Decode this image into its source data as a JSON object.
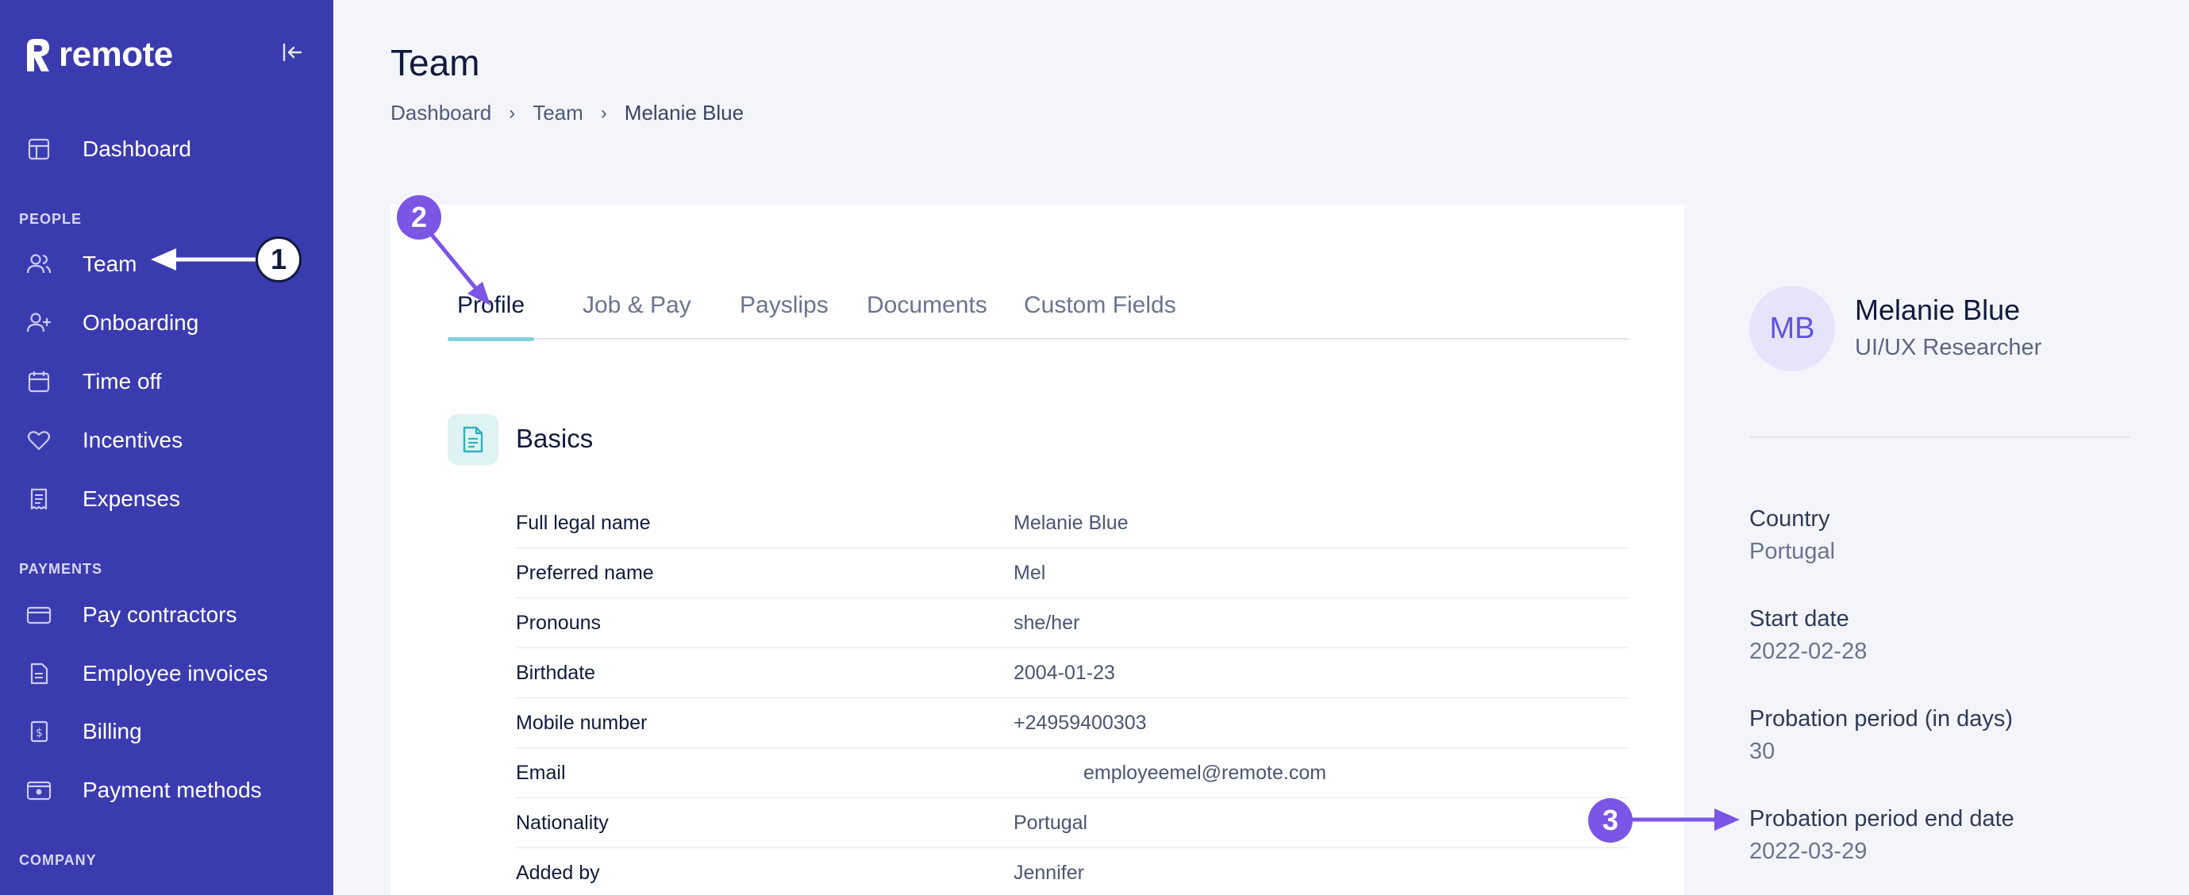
{
  "app": {
    "logo_text": "remote",
    "brand_color": "#3b3bb0"
  },
  "sidebar": {
    "collapse_icon": "collapse-left-icon",
    "sections": {
      "people": "PEOPLE",
      "payments": "PAYMENTS",
      "company": "COMPANY"
    },
    "items": [
      {
        "label": "Dashboard",
        "icon": "layout-icon"
      },
      {
        "label": "Team",
        "icon": "users-icon"
      },
      {
        "label": "Onboarding",
        "icon": "user-plus-icon"
      },
      {
        "label": "Time off",
        "icon": "calendar-icon"
      },
      {
        "label": "Incentives",
        "icon": "heart-icon"
      },
      {
        "label": "Expenses",
        "icon": "receipt-icon"
      },
      {
        "label": "Pay contractors",
        "icon": "credit-card-icon"
      },
      {
        "label": "Employee invoices",
        "icon": "invoice-icon"
      },
      {
        "label": "Billing",
        "icon": "dollar-doc-icon"
      },
      {
        "label": "Payment methods",
        "icon": "wallet-icon"
      }
    ]
  },
  "header": {
    "title": "Team",
    "breadcrumb": [
      "Dashboard",
      "Team",
      "Melanie Blue"
    ]
  },
  "tabs": [
    {
      "label": "Profile",
      "active": true
    },
    {
      "label": "Job & Pay",
      "active": false
    },
    {
      "label": "Payslips",
      "active": false
    },
    {
      "label": "Documents",
      "active": false
    },
    {
      "label": "Custom Fields",
      "active": false
    }
  ],
  "basics": {
    "title": "Basics",
    "rows": [
      {
        "key": "Full legal name",
        "value": "Melanie Blue"
      },
      {
        "key": "Preferred name",
        "value": "Mel"
      },
      {
        "key": "Pronouns",
        "value": "she/her"
      },
      {
        "key": "Birthdate",
        "value": "2004-01-23"
      },
      {
        "key": "Mobile number",
        "value": "+24959400303"
      },
      {
        "key": "Email",
        "value": "employeemel@remote.com"
      },
      {
        "key": "Nationality",
        "value": "Portugal"
      },
      {
        "key": "Added by",
        "value": "Jennifer"
      }
    ]
  },
  "employee": {
    "initials": "MB",
    "name": "Melanie Blue",
    "role": "UI/UX Researcher",
    "details": [
      {
        "label": "Country",
        "value": "Portugal"
      },
      {
        "label": "Start date",
        "value": "2022-02-28"
      },
      {
        "label": "Probation period (in days)",
        "value": "30"
      },
      {
        "label": "Probation period end date",
        "value": "2022-03-29"
      }
    ]
  },
  "annotations": {
    "one": "1",
    "two": "2",
    "three": "3",
    "accent": "#7b55e6"
  }
}
